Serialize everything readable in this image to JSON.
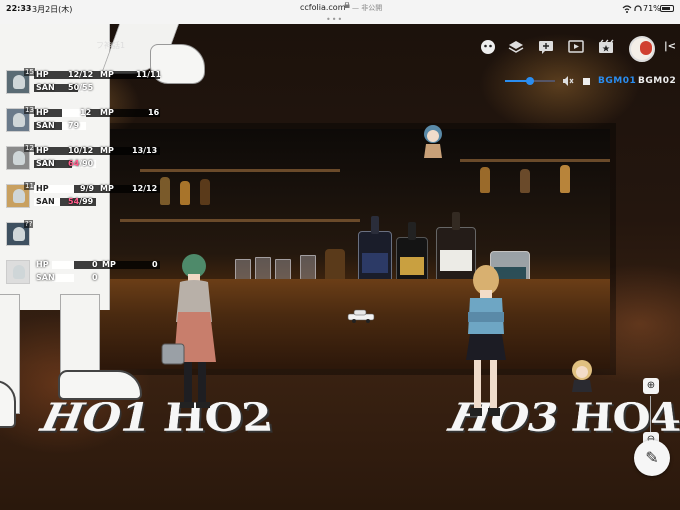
{
  "status_bar": {
    "time": "22:33",
    "date": "3月2日(木)",
    "url": "ccfolia.com",
    "privacy": "— 非公開",
    "dots": "•••",
    "battery": "71%"
  },
  "room_title_fragment": "フ神話1",
  "characters": [
    {
      "badge": "15",
      "hp_label": "HP",
      "hp": "12/12",
      "mp_label": "MP",
      "mp": "11/11",
      "san_label": "SAN",
      "san": "50/55",
      "san_current": "50",
      "san_max": "/55",
      "san_alert": false
    },
    {
      "badge": "13",
      "hp_label": "HP",
      "hp": "12",
      "mp_label": "MP",
      "mp": "16",
      "san_label": "SAN",
      "san": "79",
      "san_current": "79",
      "san_max": "",
      "san_alert": false
    },
    {
      "badge": "12",
      "hp_label": "HP",
      "hp": "10/12",
      "mp_label": "MP",
      "mp": "13/13",
      "san_label": "SAN",
      "san": "64/90",
      "san_current": "64",
      "san_max": "/90",
      "san_alert": true
    },
    {
      "badge": "11",
      "hp_label": "HP",
      "hp": "9/9",
      "mp_label": "MP",
      "mp": "12/12",
      "san_label": "SAN",
      "san": "54/99",
      "san_current": "54",
      "san_max": "/99",
      "san_alert": true
    },
    {
      "badge": "??",
      "hp_label": "",
      "hp": "",
      "mp_label": "",
      "mp": "",
      "san_label": "",
      "san": "",
      "san_current": "",
      "san_max": "",
      "san_alert": false
    },
    {
      "badge": "",
      "hp_label": "HP",
      "hp": "0",
      "mp_label": "MP",
      "mp": "0",
      "san_label": "SAN",
      "san": "0",
      "san_current": "0",
      "san_max": "",
      "san_alert": false
    }
  ],
  "toolbar": {
    "icons": [
      "dice-face-icon",
      "layers-icon",
      "chat-add-icon",
      "play-screen-icon",
      "scene-icon",
      "user-avatar",
      "collapse-panel-icon"
    ],
    "collapse_glyph": "|<"
  },
  "audio": {
    "volume": 0.5,
    "bgm1": "BGM01",
    "bgm2": "BGM02",
    "active_color": "#2a8df0"
  },
  "zoom": {
    "in": "⊕",
    "out": "⊖"
  },
  "floor_labels": {
    "left": "HO1 HO2",
    "right": "HO3 HO4"
  },
  "edit_glyph": "✎",
  "colors": {
    "san_alert": "#ff5a8a",
    "accent": "#2a8df0"
  }
}
